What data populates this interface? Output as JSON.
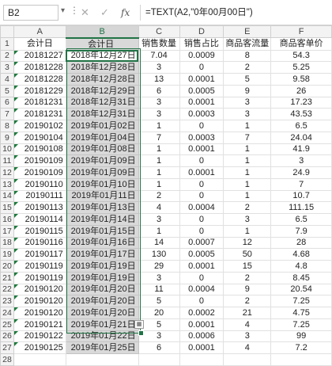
{
  "formula_bar": {
    "name_box": "B2",
    "cancel_icon": "✕",
    "enter_icon": "✓",
    "fx_label": "fx",
    "formula": "=TEXT(A2,\"0年00月00日\")"
  },
  "columns": [
    "A",
    "B",
    "C",
    "D",
    "E",
    "F"
  ],
  "row_numbers": [
    "1",
    "2",
    "3",
    "4",
    "5",
    "6",
    "7",
    "8",
    "9",
    "10",
    "11",
    "12",
    "13",
    "14",
    "15",
    "16",
    "17",
    "18",
    "19",
    "20",
    "21",
    "22",
    "23",
    "24",
    "25",
    "26",
    "27",
    "28"
  ],
  "header_row": [
    "会计日",
    "会计日",
    "销售数量",
    "销售占比",
    "商品客流量",
    "商品客单价"
  ],
  "rows": [
    [
      "20181227",
      "2018年12月27日",
      "7.04",
      "0.0009",
      "8",
      "54.3"
    ],
    [
      "20181228",
      "2018年12月28日",
      "3",
      "0",
      "2",
      "5.25"
    ],
    [
      "20181228",
      "2018年12月28日",
      "13",
      "0.0001",
      "5",
      "9.58"
    ],
    [
      "20181229",
      "2018年12月29日",
      "6",
      "0.0005",
      "9",
      "26"
    ],
    [
      "20181231",
      "2018年12月31日",
      "3",
      "0.0001",
      "3",
      "17.23"
    ],
    [
      "20181231",
      "2018年12月31日",
      "3",
      "0.0003",
      "3",
      "43.53"
    ],
    [
      "20190102",
      "2019年01月02日",
      "1",
      "0",
      "1",
      "6.5"
    ],
    [
      "20190104",
      "2019年01月04日",
      "7",
      "0.0003",
      "7",
      "24.04"
    ],
    [
      "20190108",
      "2019年01月08日",
      "1",
      "0.0001",
      "1",
      "41.9"
    ],
    [
      "20190109",
      "2019年01月09日",
      "1",
      "0",
      "1",
      "3"
    ],
    [
      "20190109",
      "2019年01月09日",
      "1",
      "0.0001",
      "1",
      "24.9"
    ],
    [
      "20190110",
      "2019年01月10日",
      "1",
      "0",
      "1",
      "7"
    ],
    [
      "20190111",
      "2019年01月11日",
      "2",
      "0",
      "1",
      "10.7"
    ],
    [
      "20190113",
      "2019年01月13日",
      "4",
      "0.0004",
      "2",
      "111.15"
    ],
    [
      "20190114",
      "2019年01月14日",
      "3",
      "0",
      "3",
      "6.5"
    ],
    [
      "20190115",
      "2019年01月15日",
      "1",
      "0",
      "1",
      "7.9"
    ],
    [
      "20190116",
      "2019年01月16日",
      "14",
      "0.0007",
      "12",
      "28"
    ],
    [
      "20190117",
      "2019年01月17日",
      "130",
      "0.0005",
      "50",
      "4.68"
    ],
    [
      "20190119",
      "2019年01月19日",
      "29",
      "0.0001",
      "15",
      "4.8"
    ],
    [
      "20190119",
      "2019年01月19日",
      "3",
      "0",
      "2",
      "8.45"
    ],
    [
      "20190120",
      "2019年01月20日",
      "11",
      "0.0004",
      "9",
      "20.54"
    ],
    [
      "20190120",
      "2019年01月20日",
      "5",
      "0",
      "2",
      "7.25"
    ],
    [
      "20190120",
      "2019年01月20日",
      "20",
      "0.0002",
      "21",
      "4.75"
    ],
    [
      "20190121",
      "2019年01月21日",
      "5",
      "0.0001",
      "4",
      "7.25"
    ],
    [
      "20190122",
      "2019年01月22日",
      "3",
      "0.0006",
      "3",
      "99"
    ],
    [
      "20190125",
      "2019年01月25日",
      "6",
      "0.0001",
      "4",
      "7.2"
    ]
  ],
  "paste_options_icon": "▦"
}
